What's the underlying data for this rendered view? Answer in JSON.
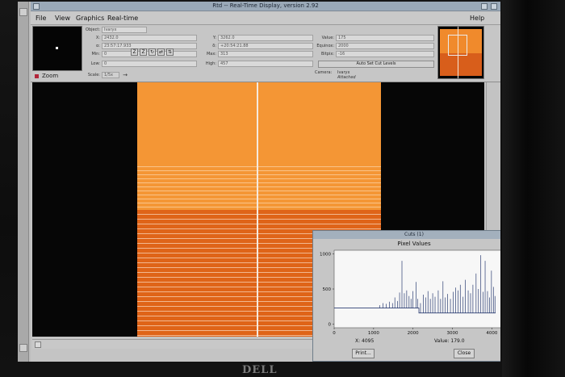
{
  "window": {
    "title": "Rtd -- Real-Time Display, version 2.92"
  },
  "menu": {
    "items": [
      "File",
      "View",
      "Graphics",
      "Real-time"
    ],
    "help": "Help"
  },
  "zoom": {
    "label": "Zoom"
  },
  "info": {
    "object_label": "Object:",
    "object_value": "Ivaryx",
    "x_label": "X:",
    "x_value": "2432.0",
    "y_label": "Y:",
    "y_value": "3262.0",
    "value_label": "Value:",
    "value_value": "175",
    "alpha_label": "α:",
    "alpha_value": "23:57:17.933",
    "delta_label": "δ:",
    "delta_value": "+20:54:21.88",
    "equinox_label": "Equinox:",
    "equinox_value": "2000",
    "min_label": "Min:",
    "min_value": "0",
    "max_label": "Max:",
    "max_value": "313",
    "bitpix_label": "Bitpix:",
    "bitpix_value": "-16",
    "low_label": "Low:",
    "low_value": "0",
    "high_label": "High:",
    "high_value": "457",
    "autocut_label": "Auto Set Cut Levels",
    "scale_label": "Scale:",
    "scale_value": "1/5x",
    "scale_arrow": "→",
    "camera_label": "Camera:",
    "camera_value": "Ivaryx",
    "camera_status": "Attached"
  },
  "toolbar_buttons": [
    "Z",
    "Z",
    "↻",
    "⇄",
    "⇅"
  ],
  "cuts": {
    "title": "Cuts (1)",
    "plot_title": "Pixel Values",
    "x_readout": "X: 4095",
    "value_readout": "Value: 179.0",
    "print_label": "Print...",
    "close_label": "Close",
    "line_color": "#2c3e73"
  },
  "chart_data": {
    "type": "line",
    "title": "Pixel Values",
    "xlabel": "",
    "ylabel": "",
    "xlim": [
      0,
      4300
    ],
    "ylim": [
      -50,
      1050
    ],
    "x_ticks": [
      "0",
      "1000",
      "2000",
      "3000",
      "4000"
    ],
    "y_ticks": [
      "0",
      "500",
      "1000"
    ],
    "x_tick_values": [
      0,
      1000,
      2000,
      3000,
      4000
    ],
    "y_tick_values": [
      0,
      500,
      1000
    ],
    "series": [
      {
        "baseline": [
          [
            0,
            230
          ],
          [
            1000,
            230
          ],
          [
            2000,
            230
          ],
          [
            2150,
            230
          ],
          [
            2150,
            160
          ],
          [
            4095,
            160
          ]
        ],
        "spikes": [
          [
            1160,
            270
          ],
          [
            1240,
            300
          ],
          [
            1320,
            290
          ],
          [
            1400,
            320
          ],
          [
            1480,
            300
          ],
          [
            1540,
            380
          ],
          [
            1610,
            330
          ],
          [
            1660,
            450
          ],
          [
            1720,
            900
          ],
          [
            1780,
            440
          ],
          [
            1840,
            480
          ],
          [
            1900,
            400
          ],
          [
            1950,
            360
          ],
          [
            2000,
            470
          ],
          [
            2080,
            600
          ],
          [
            2120,
            360
          ],
          [
            2190,
            300
          ],
          [
            2260,
            420
          ],
          [
            2320,
            380
          ],
          [
            2380,
            470
          ],
          [
            2440,
            360
          ],
          [
            2500,
            440
          ],
          [
            2560,
            390
          ],
          [
            2640,
            480
          ],
          [
            2700,
            360
          ],
          [
            2760,
            610
          ],
          [
            2820,
            380
          ],
          [
            2880,
            430
          ],
          [
            2950,
            360
          ],
          [
            3020,
            460
          ],
          [
            3080,
            520
          ],
          [
            3140,
            480
          ],
          [
            3200,
            560
          ],
          [
            3270,
            390
          ],
          [
            3330,
            630
          ],
          [
            3400,
            480
          ],
          [
            3460,
            440
          ],
          [
            3520,
            560
          ],
          [
            3600,
            720
          ],
          [
            3660,
            500
          ],
          [
            3720,
            980
          ],
          [
            3780,
            460
          ],
          [
            3830,
            900
          ],
          [
            3890,
            470
          ],
          [
            3940,
            380
          ],
          [
            3990,
            760
          ],
          [
            4040,
            530
          ],
          [
            4080,
            400
          ]
        ]
      }
    ],
    "grid": false,
    "legend": "none"
  }
}
